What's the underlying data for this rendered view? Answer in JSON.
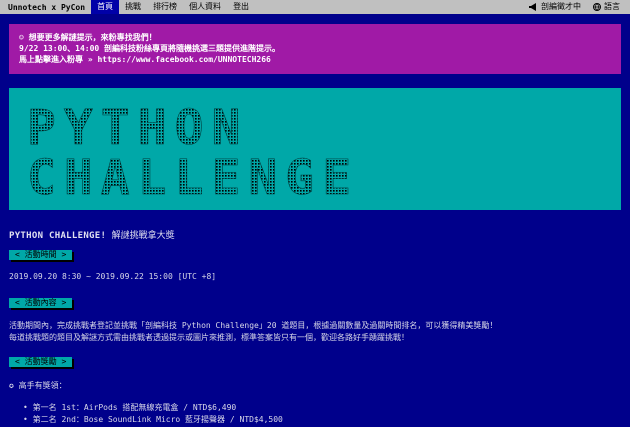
{
  "nav": {
    "brand": "Unnotech x PyCon",
    "items": [
      "首頁",
      "挑戰",
      "排行榜",
      "個人資料",
      "登出"
    ],
    "right": {
      "announce_label": "剖編徵才中",
      "language_label": "語言"
    }
  },
  "notice": {
    "line1": "☺ 想要更多解謎提示，來粉專找我們！",
    "line2": "9/22 13:00、14:00 剖編科技粉絲專頁將隨機挑選三題提供進階提示。",
    "line3": "馬上點擊進入粉專 » https://www.facebook.com/UNNOTECH266"
  },
  "hero": {
    "line1": "PYTHON",
    "line2": "CHALLENGE"
  },
  "main": {
    "title_en": "PYTHON CHALLENGE!",
    "title_zh": "解謎挑戰拿大獎",
    "section_time": "< 活動時間 >",
    "time_text": "2019.09.20 8:30 ~ 2019.09.22 15:00 [UTC +8]",
    "section_content": "< 活動內容 >",
    "content_line1": "活動期間內，完成挑戰者登記並挑戰「剖編科技 Python Challenge」20 道題目，根據過關數量及過關時間排名，可以獲得精美獎勵！",
    "content_line2": "每道挑戰題的題目及解謎方式需由挑戰者透過提示或圖片來推測，標準答案皆只有一個，歡迎各路好手踴躍挑戰！",
    "section_reward": "< 活動獎勵 >",
    "reward_heading": "高手有獎領：",
    "rewards": [
      "第一名 1st：AirPods 搭配無線充電盒 / NTD$6,490",
      "第二名 2nd：Bose SoundLink Micro 藍牙揚聲器 / NTD$4,500"
    ]
  }
}
